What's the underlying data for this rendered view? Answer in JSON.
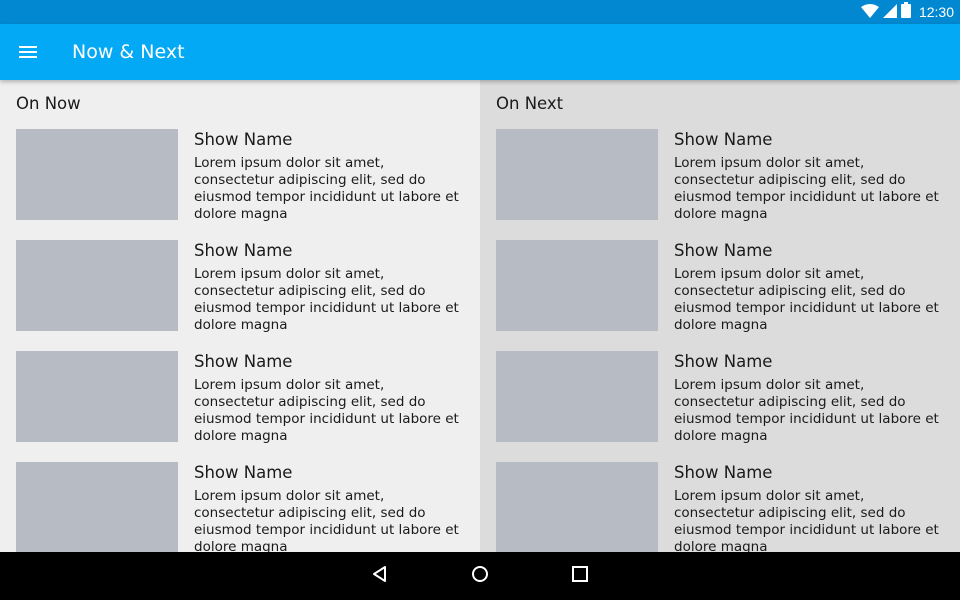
{
  "status_bar": {
    "time": "12:30",
    "icons": [
      "wifi-icon",
      "cell-signal-icon",
      "battery-icon"
    ]
  },
  "app_bar": {
    "title": "Now & Next",
    "menu_icon": "hamburger-icon"
  },
  "columns": [
    {
      "title": "On Now",
      "items": [
        {
          "name": "Show Name",
          "description": "Lorem ipsum dolor sit amet, consectetur adipiscing elit, sed do eiusmod tempor incididunt ut labore et dolore magna"
        },
        {
          "name": "Show Name",
          "description": "Lorem ipsum dolor sit amet, consectetur adipiscing elit, sed do eiusmod tempor incididunt ut labore et dolore magna"
        },
        {
          "name": "Show Name",
          "description": "Lorem ipsum dolor sit amet, consectetur adipiscing elit, sed do eiusmod tempor incididunt ut labore et dolore magna"
        },
        {
          "name": "Show Name",
          "description": "Lorem ipsum dolor sit amet, consectetur adipiscing elit, sed do eiusmod tempor incididunt ut labore et dolore magna"
        }
      ]
    },
    {
      "title": "On Next",
      "items": [
        {
          "name": "Show Name",
          "description": "Lorem ipsum dolor sit amet, consectetur adipiscing elit, sed do eiusmod tempor incididunt ut labore et dolore magna"
        },
        {
          "name": "Show Name",
          "description": "Lorem ipsum dolor sit amet, consectetur adipiscing elit, sed do eiusmod tempor incididunt ut labore et dolore magna"
        },
        {
          "name": "Show Name",
          "description": "Lorem ipsum dolor sit amet, consectetur adipiscing elit, sed do eiusmod tempor incididunt ut labore et dolore magna"
        },
        {
          "name": "Show Name",
          "description": "Lorem ipsum dolor sit amet, consectetur adipiscing elit, sed do eiusmod tempor incididunt ut labore et dolore magna"
        }
      ]
    }
  ],
  "nav_bar": {
    "buttons": [
      "back-icon",
      "home-icon",
      "recents-icon"
    ]
  },
  "colors": {
    "status_bar": "#0288d1",
    "app_bar": "#03a9f4",
    "thumbnail": "#b7bbc3",
    "column_now_bg": "#efefef",
    "column_next_bg": "#dcdcdc"
  }
}
